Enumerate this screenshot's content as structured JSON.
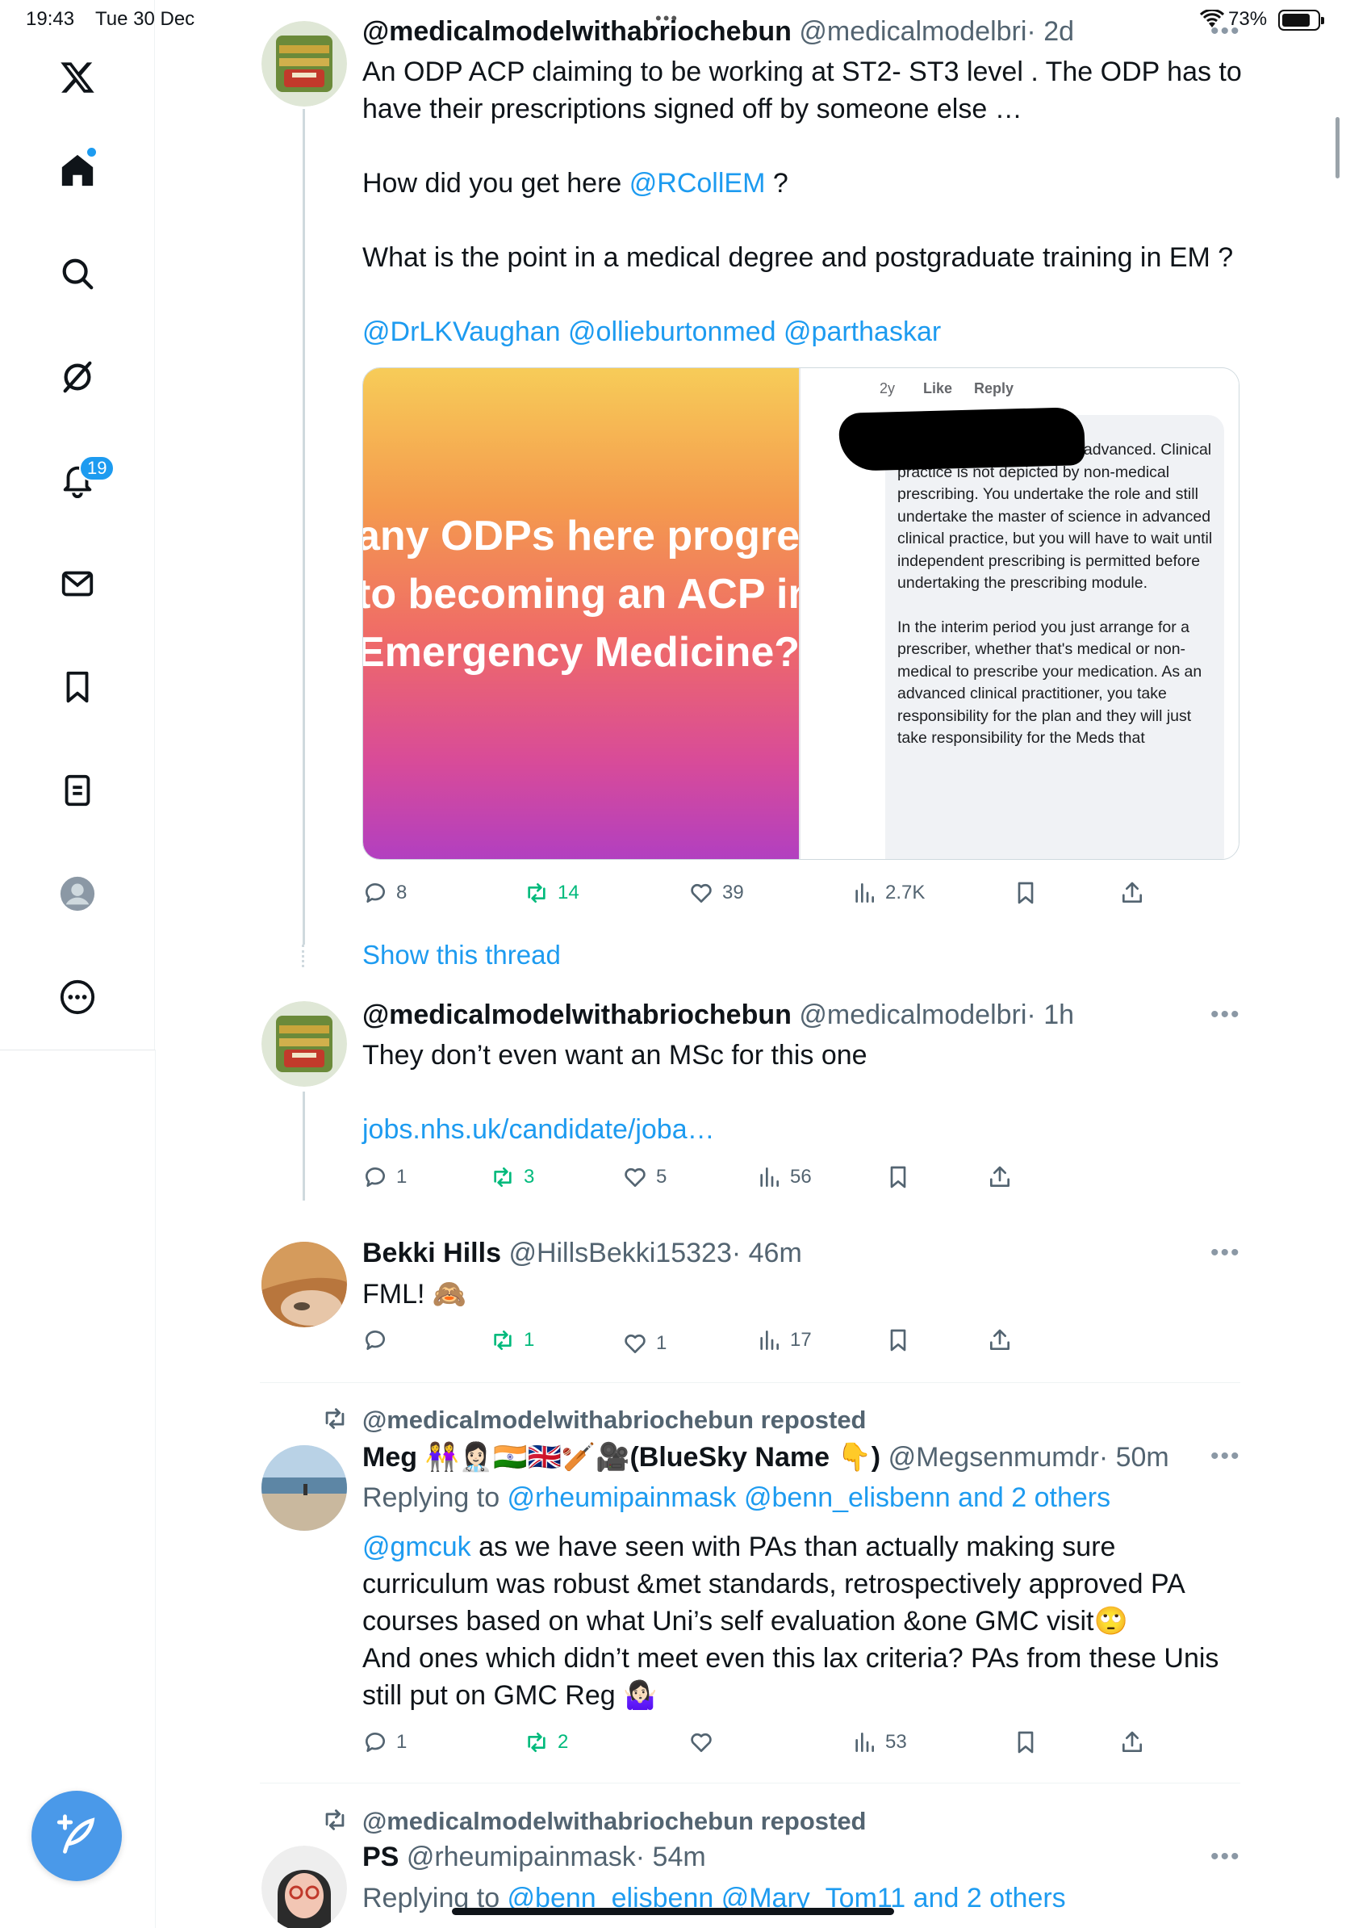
{
  "status": {
    "time": "19:43",
    "date": "Tue 30 Dec",
    "battery": "73%",
    "dots": "•••"
  },
  "sidebar": {
    "notifications_badge": "19"
  },
  "tweets": [
    {
      "name": "@medicalmodelwithabriochebun",
      "handle": "@medicalmodelbri",
      "time": "· 2d",
      "text_1": "An ODP ACP claiming to be working at ST2- ST3 level . The ODP has to have their prescriptions signed off by someone else …",
      "text_2_pre": "How did you get here ",
      "text_2_mention": "@RCollEM",
      "text_2_post": " ?",
      "text_3": "What is the point in a medical degree and postgraduate training in EM ?",
      "mentions": "@DrLKVaughan @ollieburtonmed @parthaskar",
      "media": {
        "left_line_1": "any ODPs here progre",
        "left_line_2": "to becoming an ACP in",
        "left_line_3": "Emergency Medicine?",
        "fb_age": "2y",
        "fb_like": "Like",
        "fb_reply": "Reply",
        "fb_comment_p1": "quite simple, advanced. Clinical practice is not depicted by non-medical prescribing. You undertake the role and still undertake the master of science in advanced clinical practice, but you will have to wait until independent prescribing is permitted before undertaking the prescribing module.",
        "fb_comment_p2": "In the interim period you just arrange for a prescriber, whether that's medical or non-medical to prescribe your medication. As an advanced clinical practitioner, you take responsibility for the plan and they will just take responsibility for the Meds that"
      },
      "replies": "8",
      "reposts": "14",
      "likes": "39",
      "views": "2.7K"
    },
    {
      "name": "@medicalmodelwithabriochebun",
      "handle": "@medicalmodelbri",
      "time": "· 1h",
      "text_1": "They don’t even want an MSc for this one",
      "link": "jobs.nhs.uk/candidate/joba…",
      "replies": "1",
      "reposts": "3",
      "likes": "5",
      "views": "56"
    },
    {
      "name": "Bekki Hills",
      "handle": "@HillsBekki15323",
      "time": "· 46m",
      "text_1": "FML! 🙈",
      "replies": "",
      "reposts": "1",
      "likes": "1",
      "views": "17"
    },
    {
      "repost_label": "@medicalmodelwithabriochebun reposted",
      "name": "Meg 👭👩🏻‍⚕️🇮🇳🇬🇧🏏🎥(BlueSky Name 👇)",
      "handle": "@Megsenmumdr",
      "time": "· 50m",
      "replying_label": "Replying to ",
      "replying_links": "@rheumipainmask @benn_elisbenn and 2 others",
      "text_mention": "@gmcuk",
      "text_1": " as we have seen with PAs than actually making sure curriculum was robust &met standards, retrospectively approved PA courses based on what Uni’s self evaluation &one GMC visit🙄",
      "text_2": "And ones which didn’t meet even this lax criteria? PAs from these Unis still put on GMC Reg 🤷🏻‍♀️",
      "replies": "1",
      "reposts": "2",
      "likes": "",
      "views": "53"
    },
    {
      "repost_label": "@medicalmodelwithabriochebun reposted",
      "name": "PS",
      "handle": "@rheumipainmask",
      "time": "· 54m",
      "replying_label": "Replying to ",
      "replying_links": "@benn_elisbenn @Mary_Tom11 and 2 others"
    }
  ],
  "show_thread": "Show this thread",
  "colors": {
    "accent": "#1d9bf0",
    "repost": "#00ba7c",
    "muted": "#536471"
  }
}
